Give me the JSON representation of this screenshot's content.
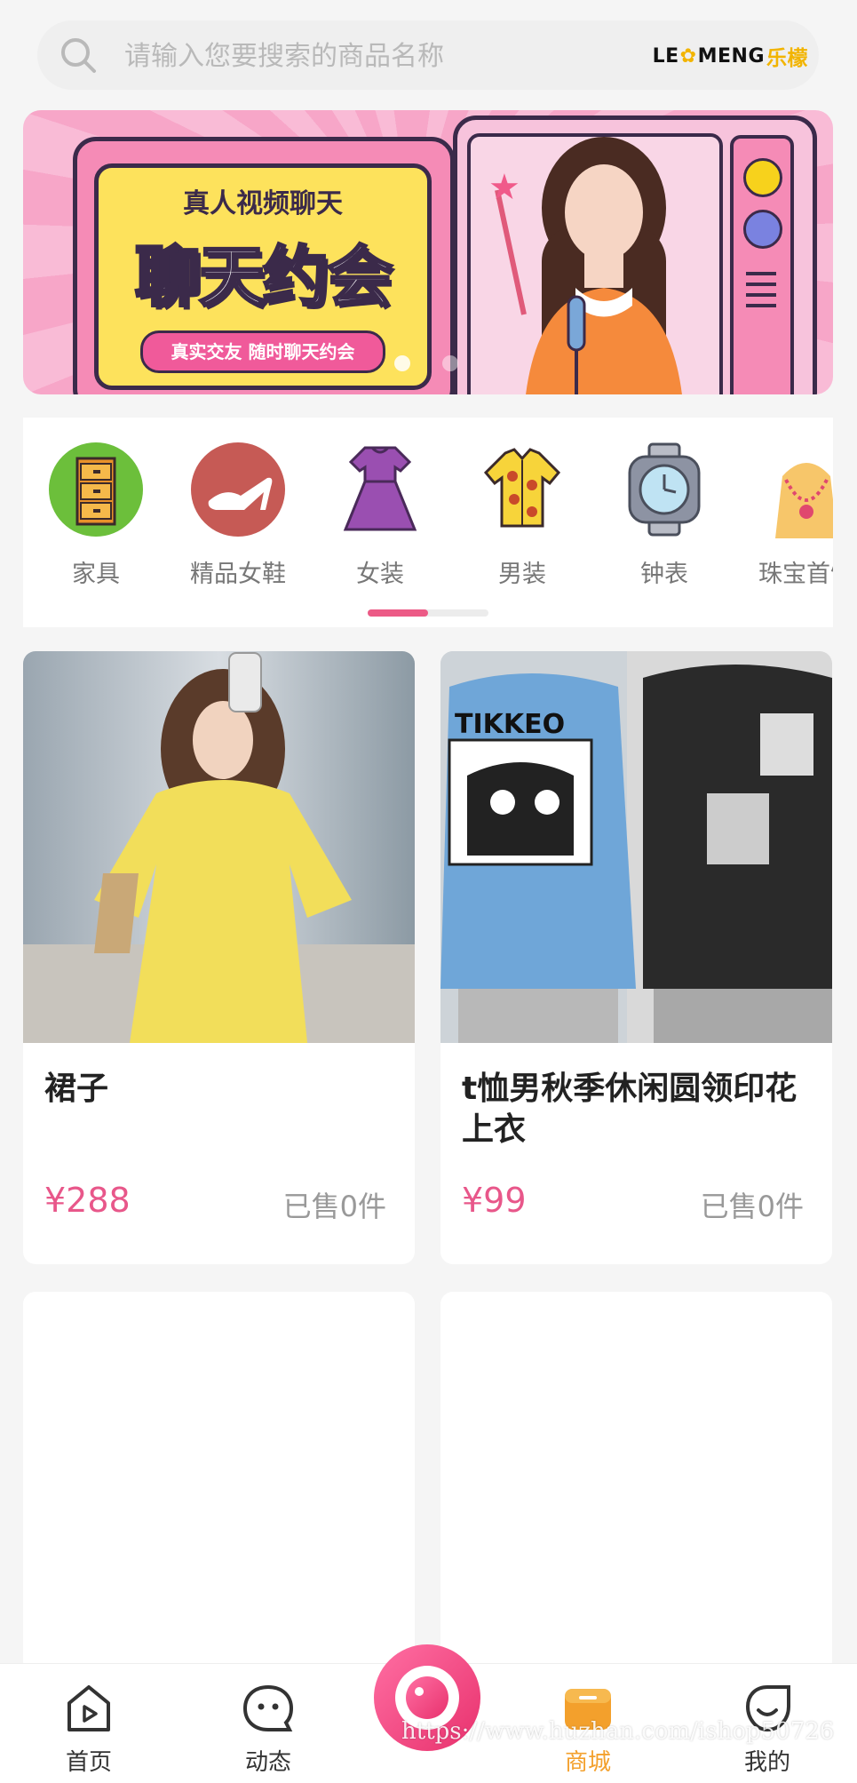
{
  "search": {
    "placeholder": "请输入您要搜索的商品名称",
    "logo_latin": "LE",
    "logo_latin2": "MENG",
    "logo_cn": "乐檬"
  },
  "banner": {
    "subtitle": "真人视频聊天",
    "title": "聊天约会",
    "tagline": "真实交友 随时聊天约会",
    "slides": 2,
    "active_slide": 1
  },
  "categories": [
    {
      "label": "家具",
      "icon": "cabinet-icon"
    },
    {
      "label": "精品女鞋",
      "icon": "high-heel-icon"
    },
    {
      "label": "女装",
      "icon": "dress-icon"
    },
    {
      "label": "男装",
      "icon": "shirt-icon"
    },
    {
      "label": "钟表",
      "icon": "watch-icon"
    },
    {
      "label": "珠宝首饰",
      "icon": "necklace-icon"
    }
  ],
  "products": [
    {
      "title": "裙子",
      "price": "¥288",
      "sold": "已售0件"
    },
    {
      "title": "t恤男秋季休闲圆领印花上衣",
      "price": "¥99",
      "sold": "已售0件"
    }
  ],
  "nav": {
    "home": "首页",
    "feed": "动态",
    "mall": "商城",
    "mine": "我的",
    "active": "mall"
  },
  "watermark": "https://www.huzhan.com/ishop50726",
  "colors": {
    "accent_pink": "#ec5a86",
    "price_pink": "#e8578a",
    "active_orange": "#f3a02c"
  }
}
